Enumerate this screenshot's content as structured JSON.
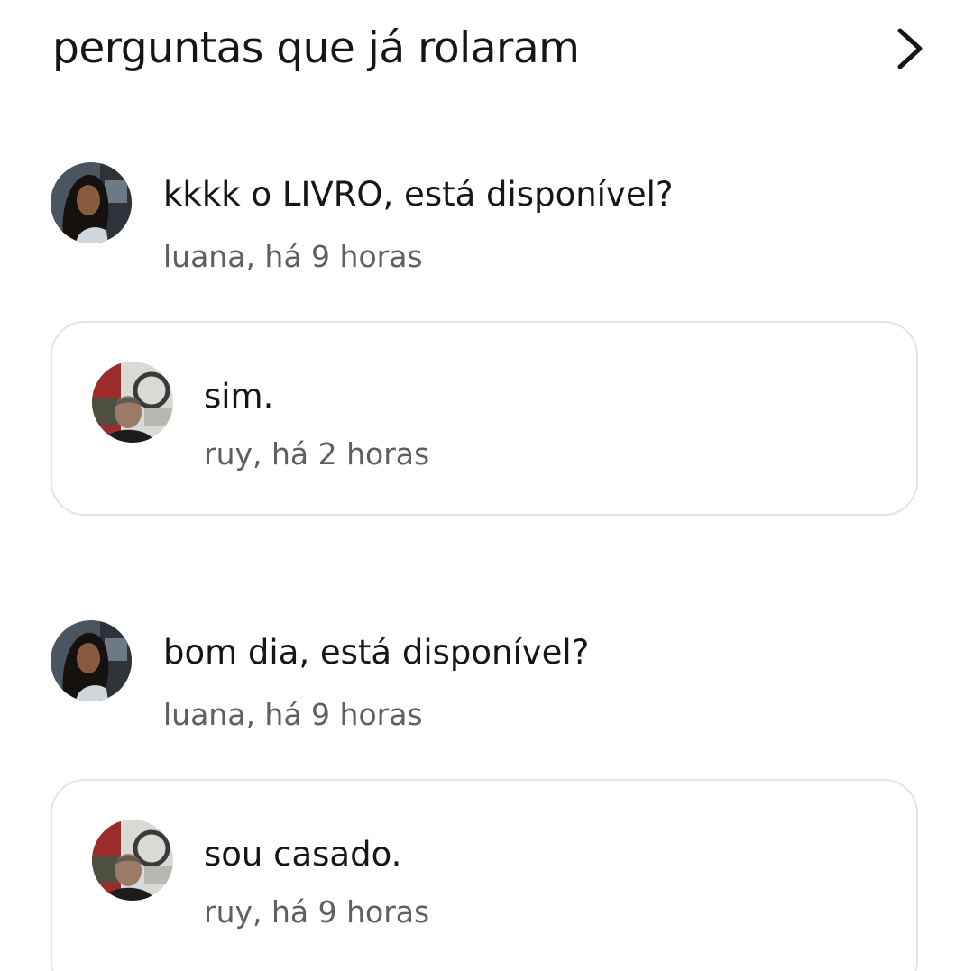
{
  "header": {
    "title": "perguntas que já rolaram",
    "chevron_icon": "chevron-right-icon"
  },
  "questions": [
    {
      "text": "kkkk o LIVRO, está disponível?",
      "meta": "luana, há 9 horas",
      "answer": {
        "text": "sim.",
        "meta": "ruy, há 2 horas"
      }
    },
    {
      "text": "bom dia, está disponível?",
      "meta": "luana, há 9 horas",
      "answer": {
        "text": "sou casado.",
        "meta": "ruy, há 9 horas"
      }
    }
  ],
  "colors": {
    "text_primary": "#161616",
    "text_secondary": "#5f5f5f",
    "card_border": "#e4e4e4",
    "background": "#ffffff"
  }
}
